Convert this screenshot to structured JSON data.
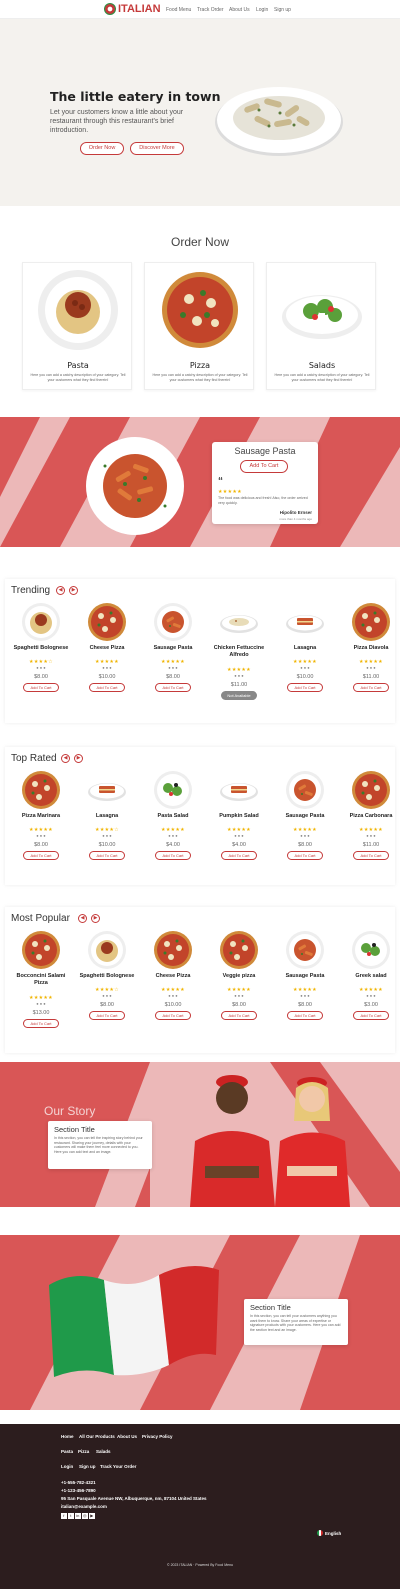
{
  "header": {
    "brand": "ITALIAN",
    "nav": [
      "Food Menu",
      "Track Order",
      "About Us",
      "Login",
      "Sign up"
    ]
  },
  "hero": {
    "title": "The little eatery in town",
    "text": "Let your customers know a little about your restaurant through this restaurant's brief introduction.",
    "btn_order": "Order Now",
    "btn_discover": "Discover More"
  },
  "order": {
    "title": "Order Now",
    "cards": [
      {
        "name": "Pasta",
        "desc": "Here you can add a catchy description of your category. Tell your customers what they find therein!"
      },
      {
        "name": "Pizza",
        "desc": "Here you can add a catchy description of your category. Tell your customers what they find therein!"
      },
      {
        "name": "Salads",
        "desc": "Here you can add a catchy description of your category. Tell your customers what they find therein!"
      }
    ]
  },
  "featured": {
    "title": "Sausage Pasta",
    "btn": "Add To Cart",
    "quote": "“",
    "review": "The food was delicious and fresh! Also, the order arrived very quickly.",
    "author": "Hipolito Ernser",
    "when": "more than 4 months ago"
  },
  "trending": {
    "title": "Trending",
    "items": [
      {
        "name": "Spaghetti Bolognese",
        "price": "$8.00",
        "btn": "Add To Cart",
        "stars": "★★★★☆",
        "food": "spaghetti"
      },
      {
        "name": "Cheese Pizza",
        "price": "$10.00",
        "btn": "Add To Cart",
        "stars": "★★★★★",
        "food": "pizza"
      },
      {
        "name": "Sausage Pasta",
        "price": "$8.00",
        "btn": "Add To Cart",
        "stars": "★★★★★",
        "food": "penne"
      },
      {
        "name": "Chicken Fettuccine Alfredo",
        "price": "$11.00",
        "btn": "Not Available",
        "stars": "★★★★★",
        "food": "alfredo",
        "na": true
      },
      {
        "name": "Lasagna",
        "price": "$10.00",
        "btn": "Add To Cart",
        "stars": "★★★★★",
        "food": "lasagna"
      },
      {
        "name": "Pizza Diavola",
        "price": "$11.00",
        "btn": "Add To Cart",
        "stars": "★★★★★",
        "food": "pizza"
      }
    ]
  },
  "toprated": {
    "title": "Top Rated",
    "items": [
      {
        "name": "Pizza Marinara",
        "price": "$8.00",
        "btn": "Add To Cart",
        "stars": "★★★★★",
        "food": "pizza"
      },
      {
        "name": "Lasagna",
        "price": "$10.00",
        "btn": "Add To Cart",
        "stars": "★★★★☆",
        "food": "lasagna"
      },
      {
        "name": "Pasta Salad",
        "price": "$4.00",
        "btn": "Add To Cart",
        "stars": "★★★★★",
        "food": "salad"
      },
      {
        "name": "Pumpkin Salad",
        "price": "$4.00",
        "btn": "Add To Cart",
        "stars": "★★★★★",
        "food": "lasagna"
      },
      {
        "name": "Sausage Pasta",
        "price": "$8.00",
        "btn": "Add To Cart",
        "stars": "★★★★★",
        "food": "penne"
      },
      {
        "name": "Pizza Carbonara",
        "price": "$11.00",
        "btn": "Add To Cart",
        "stars": "★★★★★",
        "food": "pizza"
      }
    ]
  },
  "popular": {
    "title": "Most Popular",
    "items": [
      {
        "name": "Bocconcini Salami Pizza",
        "price": "$13.00",
        "btn": "Add To Cart",
        "stars": "★★★★★",
        "food": "pizza"
      },
      {
        "name": "Spaghetti Bolognese",
        "price": "$8.00",
        "btn": "Add To Cart",
        "stars": "★★★★☆",
        "food": "spaghetti"
      },
      {
        "name": "Cheese Pizza",
        "price": "$10.00",
        "btn": "Add To Cart",
        "stars": "★★★★★",
        "food": "pizza"
      },
      {
        "name": "Veggie pizza",
        "price": "$8.00",
        "btn": "Add To Cart",
        "stars": "★★★★★",
        "food": "pizza"
      },
      {
        "name": "Sausage Pasta",
        "price": "$8.00",
        "btn": "Add To Cart",
        "stars": "★★★★★",
        "food": "penne"
      },
      {
        "name": "Greek salad",
        "price": "$3.00",
        "btn": "Add To Cart",
        "stars": "★★★★★",
        "food": "salad"
      }
    ]
  },
  "story": {
    "title": "Our Story",
    "box_title": "Section Title",
    "box_text": "In this section, you can tell the inspiring story behind your restaurant. Sharing your journey, details with your customers will make them feel more connected to you. Here you can add text and an image."
  },
  "flag": {
    "box_title": "Section Title",
    "box_text": "In this section, you can tell your customers anything you want them to know. Share your areas of expertise or signature products with your customers. Here you can add the section text and an image."
  },
  "footer": {
    "links1": [
      "Home",
      "All Our Products",
      "About Us",
      "Privacy Policy"
    ],
    "links2": [
      "Pasta",
      "Pizza",
      "Salads"
    ],
    "links3": [
      "Login",
      "Sign up",
      "Track Your Order"
    ],
    "phone1": "+1-555-782-4321",
    "phone2": "+1-123-456-7890",
    "address": "95 San Pasquale Avenue NW, Albuquerque, nm, 87104 United States",
    "email": "italian@example.com",
    "lang": "English",
    "copyright": "© 2023 ITALIAN · Powered By Food Menu"
  },
  "colors": {
    "accent": "#c53a3a",
    "pink": "#ecb8b8",
    "footer": "#2c1d1e"
  }
}
